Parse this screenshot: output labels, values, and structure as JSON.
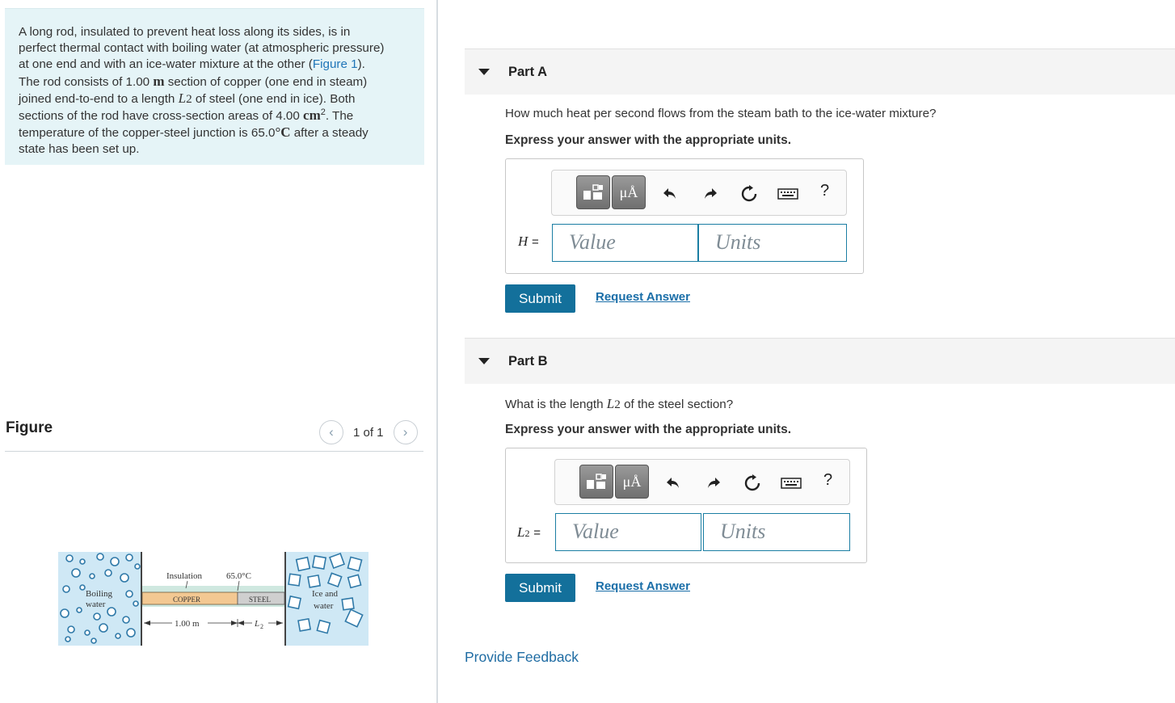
{
  "problem": {
    "lines": [
      {
        "segments": [
          {
            "t": "A long rod, insulated to prevent heat loss along its sides, is in"
          }
        ]
      },
      {
        "segments": [
          {
            "t": "perfect thermal contact with boiling water (at atmospheric pressure)"
          }
        ]
      },
      {
        "segments": [
          {
            "t": "at one end and with an ice-water mixture at the other ("
          },
          {
            "t": "Figure 1",
            "link": true
          },
          {
            "t": ")."
          }
        ]
      },
      {
        "segments": [
          {
            "t": "The rod consists of 1.00 "
          },
          {
            "t": "m",
            "cls": "mathrm"
          },
          {
            "t": " section of copper (one end in steam)"
          }
        ]
      },
      {
        "segments": [
          {
            "t": "joined end-to-end to a length "
          },
          {
            "t": "L",
            "cls": "math"
          },
          {
            "t": "2",
            "cls": "serif"
          },
          {
            "t": " of steel (one end in ice). Both"
          }
        ]
      },
      {
        "segments": [
          {
            "t": "sections of the rod have cross-section areas of 4.00 "
          },
          {
            "t": "cm",
            "cls": "mathrm"
          },
          {
            "t": "2",
            "sup": true
          },
          {
            "t": ". The"
          }
        ]
      },
      {
        "segments": [
          {
            "t": "temperature of the copper-steel junction is 65.0"
          },
          {
            "t": "°C",
            "cls": "mathrm"
          },
          {
            "t": " after a steady"
          }
        ]
      },
      {
        "segments": [
          {
            "t": "state has been set up."
          }
        ]
      }
    ]
  },
  "figure": {
    "title": "Figure",
    "pager": "1 of 1",
    "prev_icon": "chevron-left-icon",
    "next_icon": "chevron-right-icon",
    "labels": {
      "insulation": "Insulation",
      "temp": "65.0°C",
      "boiling": "Boiling",
      "water": "water",
      "copper": "COPPER",
      "steel": "STEEL",
      "ice_and": "Ice and",
      "ice_water": "water",
      "length_copper": "1.00 m",
      "length_steel_var": "L",
      "length_steel_sub": "2"
    }
  },
  "parts": [
    {
      "title": "Part A",
      "question_segments": [
        {
          "t": "How much heat per second flows from the steam bath to the ice-water mixture?"
        }
      ],
      "instruction": "Express your answer with the appropriate units.",
      "var": "H",
      "var_sub": "",
      "equals": "=",
      "value_placeholder": "Value",
      "units_placeholder": "Units",
      "submit": "Submit",
      "request": "Request Answer"
    },
    {
      "title": "Part B",
      "question_segments": [
        {
          "t": "What is the length "
        },
        {
          "t": "L",
          "cls": "math"
        },
        {
          "t": "2",
          "cls": "serif"
        },
        {
          "t": " of the steel section?"
        }
      ],
      "instruction": "Express your answer with the appropriate units.",
      "var": "L",
      "var_sub": "2",
      "equals": "=",
      "value_placeholder": "Value",
      "units_placeholder": "Units",
      "submit": "Submit",
      "request": "Request Answer"
    }
  ],
  "toolbar": {
    "units_label": "μÅ",
    "help_label": "?",
    "icons": [
      "templates-icon",
      "units-icon",
      "undo-icon",
      "redo-icon",
      "reset-icon",
      "keyboard-icon",
      "help-icon"
    ]
  },
  "feedback": "Provide Feedback",
  "colors": {
    "accent": "#13709b",
    "link": "#1a6ea8",
    "problem_bg": "#e5f4f7",
    "field_border": "#1b7ea3"
  }
}
